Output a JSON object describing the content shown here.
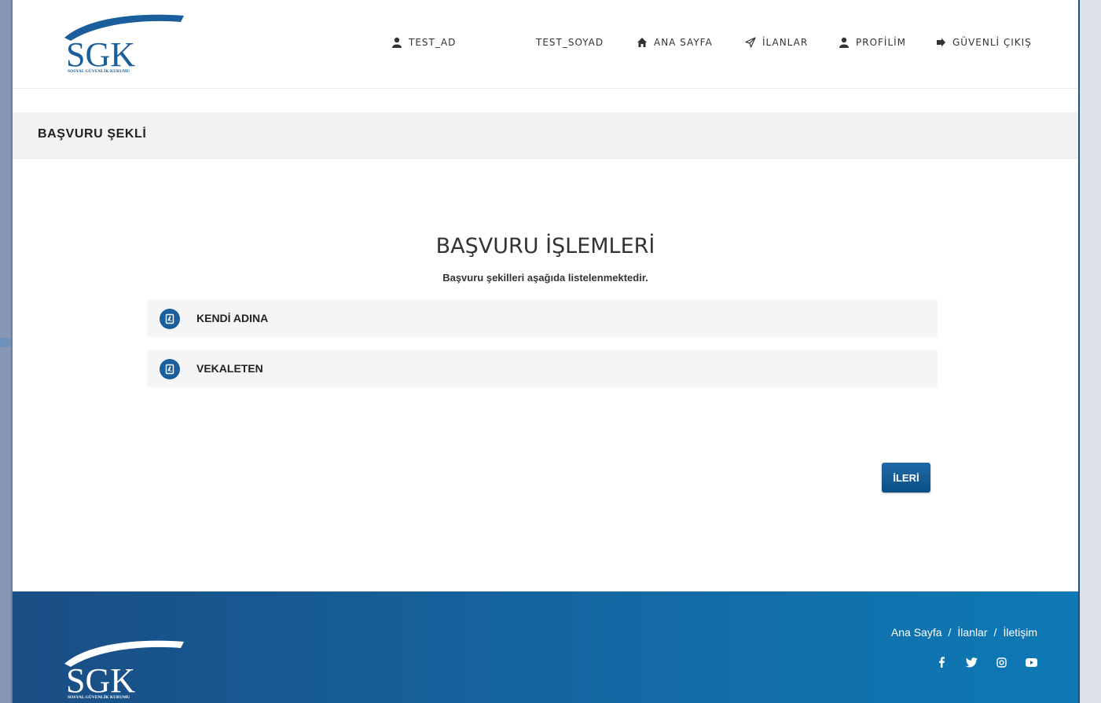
{
  "header": {
    "logo_text": "SGK",
    "logo_subtext": "SOSYAL GÜVENLİK KURUMU",
    "nav": {
      "first_name": "TEST_AD",
      "last_name": "TEST_SOYAD",
      "home": "ANA SAYFA",
      "listings": "İLANLAR",
      "profile": "PROFİLİM",
      "logout": "GÜVENLİ ÇIKIŞ"
    }
  },
  "page_title": "BAŞVURU ŞEKLİ",
  "section": {
    "title": "BAŞVURU İŞLEMLERİ",
    "subtitle": "Başvuru şekilleri aşağıda listelenmektedir."
  },
  "options": [
    {
      "label": "KENDİ ADINA"
    },
    {
      "label": "VEKALETEN"
    }
  ],
  "next_button": "İLERİ",
  "footer": {
    "links": [
      "Ana Sayfa",
      "İlanlar",
      "İletişim"
    ],
    "separator": "/",
    "social": [
      "facebook-icon",
      "twitter-icon",
      "instagram-icon",
      "youtube-icon"
    ]
  },
  "colors": {
    "primary": "#1b5e9c",
    "footer_start": "#1a4d84",
    "footer_end": "#0d79b5",
    "arrow": "#6d93bd"
  }
}
